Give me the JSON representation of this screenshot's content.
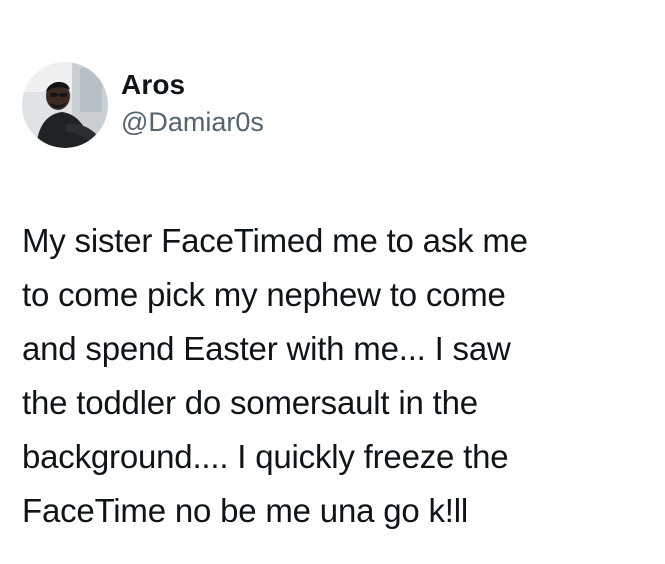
{
  "user": {
    "display_name": "Aros",
    "handle": "@Damiar0s"
  },
  "tweet": {
    "lines": [
      "My sister FaceTimed me to ask me",
      "to come pick my nephew to come",
      "and spend Easter with me... I saw",
      "the toddler do somersault in the",
      "background.... I quickly freeze the",
      "FaceTime no be me una go k!ll"
    ]
  },
  "colors": {
    "text": "#0f1419",
    "secondary_text": "#536471",
    "background": "#ffffff"
  }
}
